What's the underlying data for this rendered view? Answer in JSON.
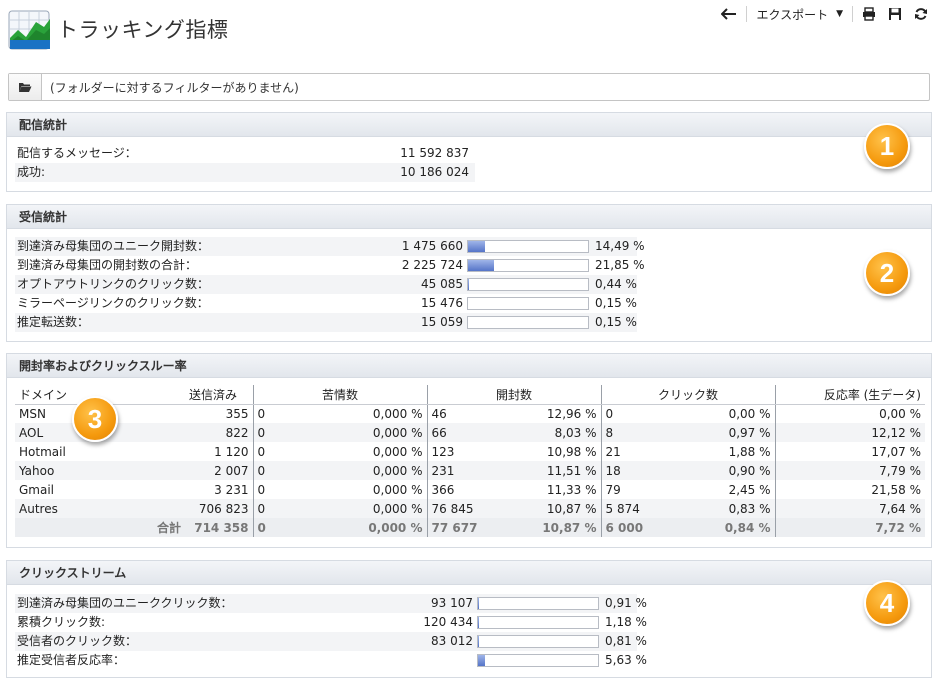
{
  "page": {
    "title": "トラッキング指標"
  },
  "toolbar": {
    "export_label": "エクスポート"
  },
  "filter": {
    "text": "(フォルダーに対するフィルターがありません)"
  },
  "badges": [
    "1",
    "2",
    "3",
    "4"
  ],
  "delivery": {
    "title": "配信統計",
    "rows": [
      {
        "label": "配信するメッセージ：",
        "value": "11 592 837"
      },
      {
        "label": "成功:",
        "value": "10 186 024"
      }
    ]
  },
  "reception": {
    "title": "受信統計",
    "rows": [
      {
        "label": "到達済み母集団のユニーク開封数：",
        "value": "1 475 660",
        "pct": "14,49 %",
        "ratio": 0.1449
      },
      {
        "label": "到達済み母集団の開封数の合計：",
        "value": "2 225 724",
        "pct": "21,85 %",
        "ratio": 0.2185
      },
      {
        "label": "オプトアウトリンクのクリック数：",
        "value": "45 085",
        "pct": "0,44 %",
        "ratio": 0.0044
      },
      {
        "label": "ミラーページリンクのクリック数：",
        "value": "15 476",
        "pct": "0,15 %",
        "ratio": 0.0015
      },
      {
        "label": "推定転送数：",
        "value": "15 059",
        "pct": "0,15 %",
        "ratio": 0.0015
      }
    ]
  },
  "rates": {
    "title": "開封率およびクリックスルー率",
    "headers": {
      "domain": "ドメイン",
      "sent": "送信済み",
      "complaints": "苦情数",
      "opens": "開封数",
      "clicks": "クリック数",
      "reactivity": "反応率 (生データ)"
    },
    "rows": [
      {
        "domain": "MSN",
        "sent": "355",
        "c": "0",
        "cp": "0,000 %",
        "o": "46",
        "op": "12,96 %",
        "k": "0",
        "kp": "0,00 %",
        "r": "0,00 %"
      },
      {
        "domain": "AOL",
        "sent": "822",
        "c": "0",
        "cp": "0,000 %",
        "o": "66",
        "op": "8,03 %",
        "k": "8",
        "kp": "0,97 %",
        "r": "12,12 %"
      },
      {
        "domain": "Hotmail",
        "sent": "1 120",
        "c": "0",
        "cp": "0,000 %",
        "o": "123",
        "op": "10,98 %",
        "k": "21",
        "kp": "1,88 %",
        "r": "17,07 %"
      },
      {
        "domain": "Yahoo",
        "sent": "2 007",
        "c": "0",
        "cp": "0,000 %",
        "o": "231",
        "op": "11,51 %",
        "k": "18",
        "kp": "0,90 %",
        "r": "7,79 %"
      },
      {
        "domain": "Gmail",
        "sent": "3 231",
        "c": "0",
        "cp": "0,000 %",
        "o": "366",
        "op": "11,33 %",
        "k": "79",
        "kp": "2,45 %",
        "r": "21,58 %"
      },
      {
        "domain": "Autres",
        "sent": "706 823",
        "c": "0",
        "cp": "0,000 %",
        "o": "76 845",
        "op": "10,87 %",
        "k": "5 874",
        "kp": "0,83 %",
        "r": "7,64 %"
      }
    ],
    "total": {
      "label": "合計",
      "sent": "714 358",
      "c": "0",
      "cp": "0,000 %",
      "o": "77 677",
      "op": "10,87 %",
      "k": "6 000",
      "kp": "0,84 %",
      "r": "7,72 %"
    }
  },
  "clickstream": {
    "title": "クリックストリーム",
    "rows": [
      {
        "label": "到達済み母集団のユニーククリック数：",
        "value": "93 107",
        "pct": "0,91 %",
        "ratio": 0.0091
      },
      {
        "label": "累積クリック数:",
        "value": "120 434",
        "pct": "1,18 %",
        "ratio": 0.0118
      },
      {
        "label": "受信者のクリック数：",
        "value": "83 012",
        "pct": "0,81 %",
        "ratio": 0.0081
      },
      {
        "label": "推定受信者反応率：",
        "value": "",
        "pct": "5,63 %",
        "ratio": 0.0563
      }
    ]
  }
}
